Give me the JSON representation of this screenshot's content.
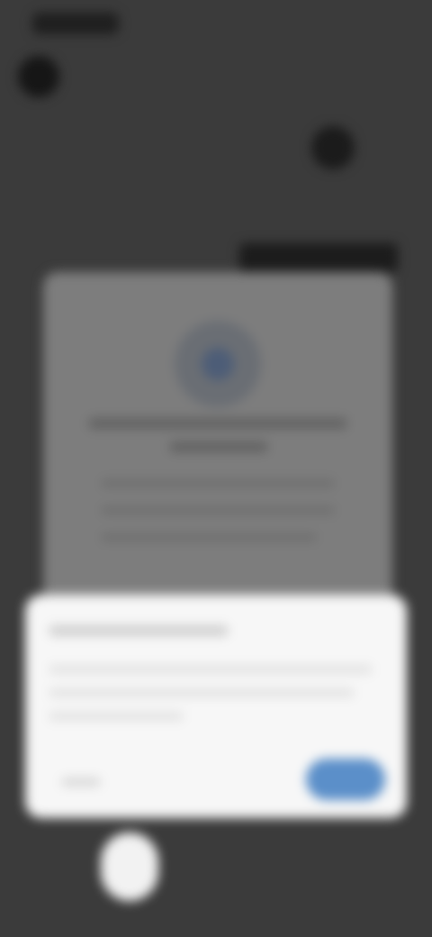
{
  "status_bar": {
    "time": ""
  },
  "dialog": {
    "title": "",
    "cancel_label": "",
    "confirm_label": ""
  },
  "colors": {
    "background": "#3b3b3b",
    "card": "#7d7d7d",
    "sheet": "#f7f7f7",
    "accent": "#5b8fc9"
  },
  "icons": {
    "back": "arrow-back-icon",
    "profile": "avatar",
    "emblem": "shield-icon",
    "home": "home-button"
  }
}
